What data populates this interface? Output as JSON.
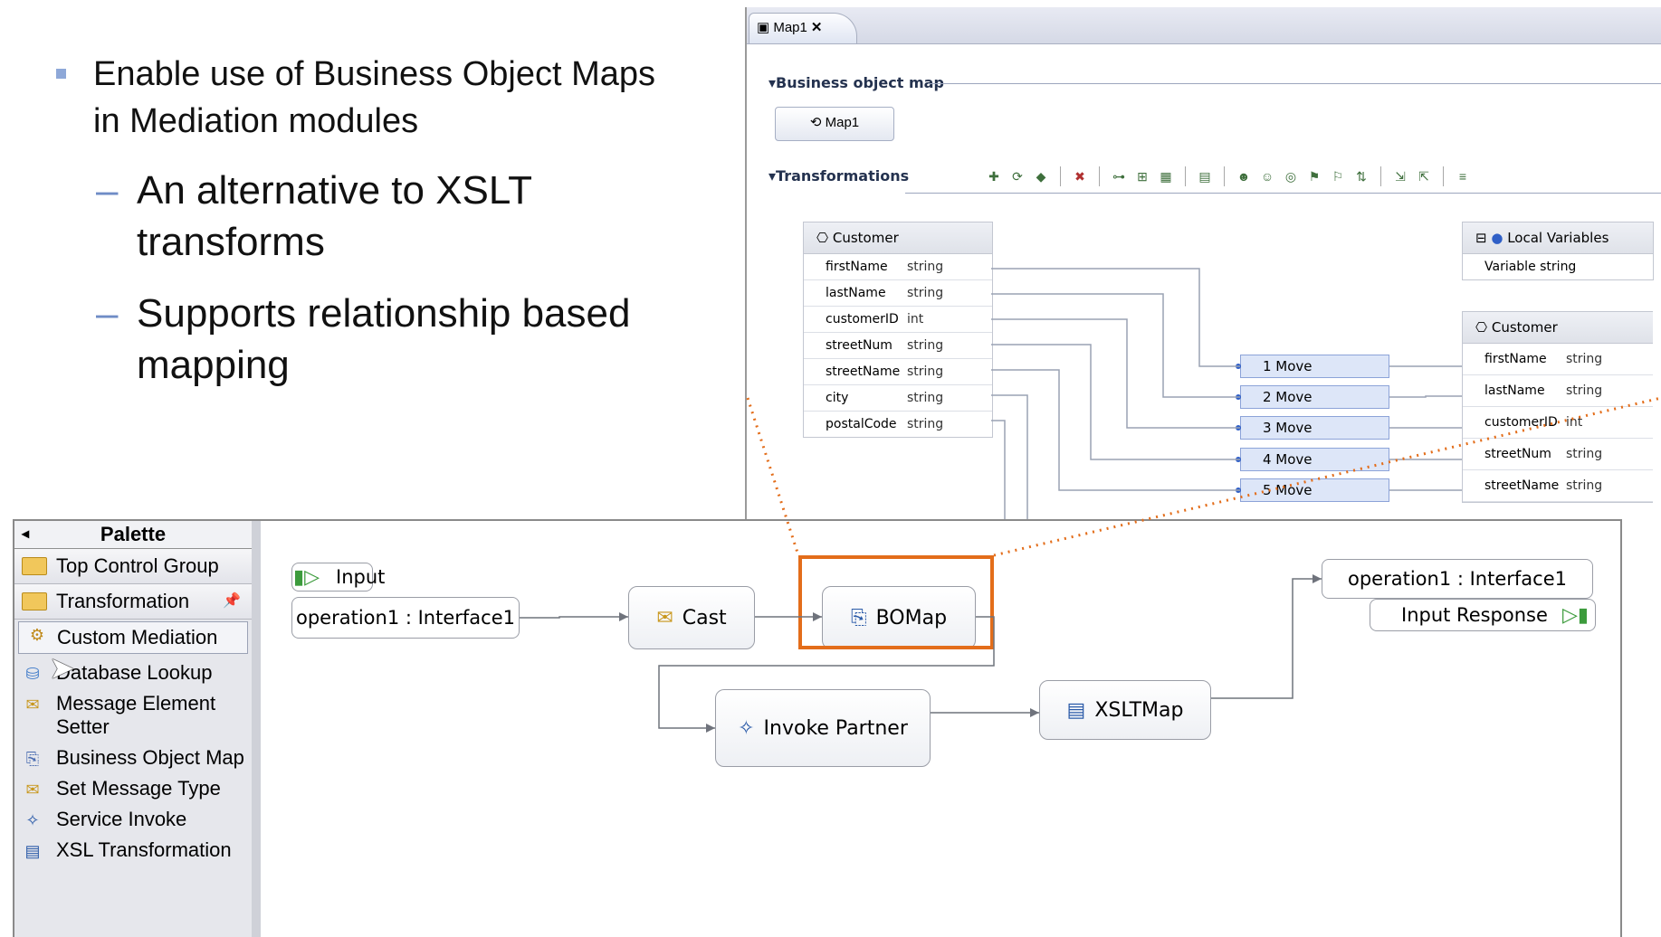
{
  "slide": {
    "bullet": "Enable use of Business Object Maps in Mediation modules",
    "sub_bullets": [
      "An alternative to XSLT transforms",
      "Supports relationship based mapping"
    ]
  },
  "map_editor": {
    "tab_label": "Map1",
    "tab_close": "✕",
    "section_bo_map": "Business object map",
    "map_button": "Map1",
    "section_transformations": "Transformations",
    "source": {
      "title": "Customer",
      "fields": [
        {
          "name": "firstName",
          "type": "string"
        },
        {
          "name": "lastName",
          "type": "string"
        },
        {
          "name": "customerID",
          "type": "int"
        },
        {
          "name": "streetNum",
          "type": "string"
        },
        {
          "name": "streetName",
          "type": "string"
        },
        {
          "name": "city",
          "type": "string"
        },
        {
          "name": "postalCode",
          "type": "string"
        }
      ]
    },
    "local_vars": {
      "title": "Local Variables",
      "row": "Variable string"
    },
    "target": {
      "title": "Customer",
      "fields": [
        {
          "name": "firstName",
          "type": "string"
        },
        {
          "name": "lastName",
          "type": "string"
        },
        {
          "name": "customerID",
          "type": "int"
        },
        {
          "name": "streetNum",
          "type": "string"
        },
        {
          "name": "streetName",
          "type": "string"
        }
      ]
    },
    "moves": [
      "1  Move",
      "2  Move",
      "3  Move",
      "4  Move",
      "5  Move"
    ]
  },
  "palette": {
    "title": "Palette",
    "groups": [
      "Top Control Group",
      "Transformation"
    ],
    "items": [
      "Custom Mediation",
      "Database Lookup",
      "Message Element Setter",
      "Business Object Map",
      "Set Message Type",
      "Service Invoke",
      "XSL Transformation"
    ]
  },
  "flow": {
    "input_label": "Input",
    "input_operation": "operation1 : Interface1",
    "cast": "Cast",
    "bomap": "BOMap",
    "invoke_partner": "Invoke Partner",
    "xsltmap": "XSLTMap",
    "output_operation": "operation1 : Interface1",
    "input_response": "Input Response"
  },
  "colors": {
    "highlight": "#e36d1a",
    "bullet_accent": "#6f8cc6"
  }
}
